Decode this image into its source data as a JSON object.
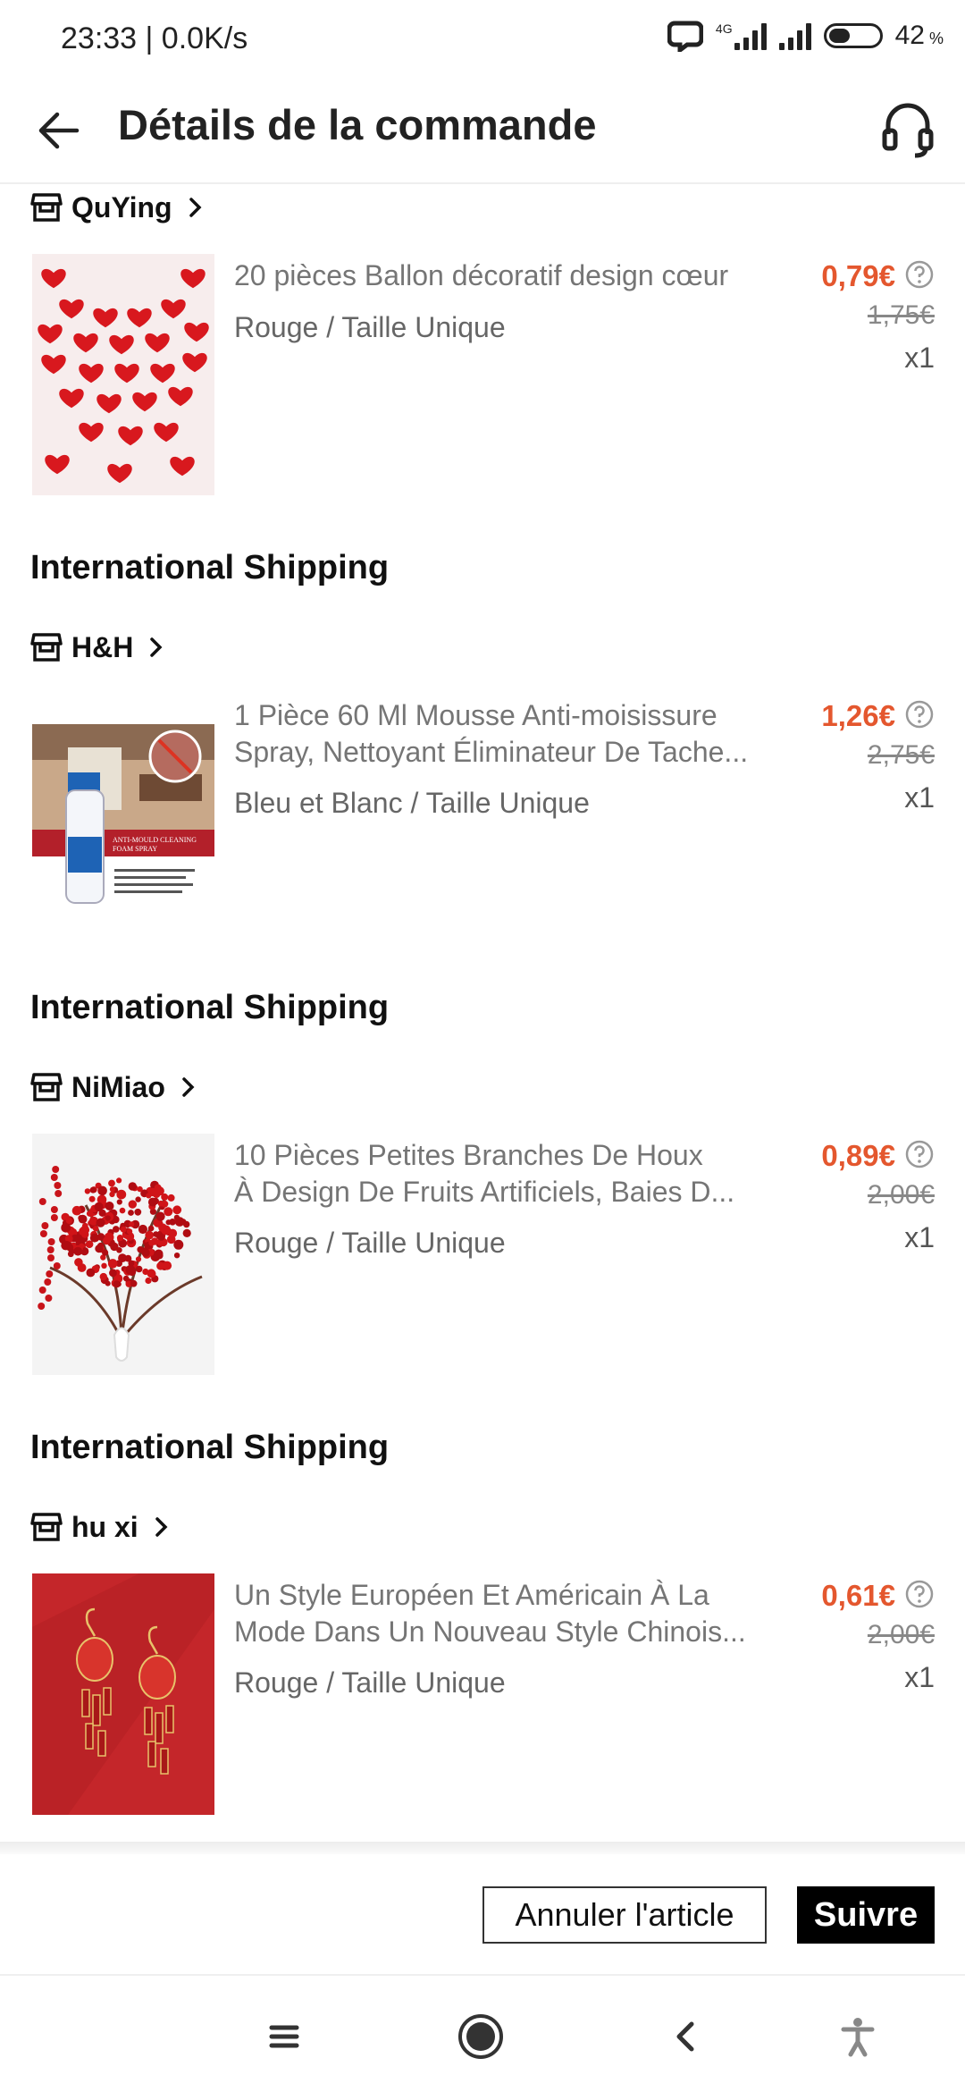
{
  "status_bar": {
    "time": "23:33 | 0.0K/s",
    "network": "4G",
    "battery": "42",
    "battery_level": 0.42
  },
  "header": {
    "title": "Détails de la commande",
    "back_icon": "back-arrow-icon",
    "support_icon": "headset-icon"
  },
  "orders": [
    {
      "section_title": "",
      "store": "QuYing",
      "product": {
        "title_lines": [
          "20 pièces Ballon décoratif design cœur"
        ],
        "variant": "Rouge / Taille Unique",
        "price": "0,79€",
        "original_price": "1,75€",
        "quantity": "x1",
        "image": "red-heart-balloons"
      }
    },
    {
      "section_title": "International Shipping",
      "store": "H&H",
      "product": {
        "title_lines": [
          "1 Pièce 60 Ml Mousse Anti-moisissure",
          "Spray, Nettoyant Éliminateur De Tache..."
        ],
        "variant": "Bleu et Blanc / Taille Unique",
        "price": "1,26€",
        "original_price": "2,75€",
        "quantity": "x1",
        "image": "anti-mould-spray-bottle",
        "image_caption": "ANTI-MOULD CLEANING FOAM SPRAY"
      }
    },
    {
      "section_title": "International Shipping",
      "store": "NiMiao",
      "product": {
        "title_lines": [
          "10 Pièces Petites Branches De Houx",
          "À Design De Fruits Artificiels, Baies D..."
        ],
        "variant": "Rouge / Taille Unique",
        "price": "0,89€",
        "original_price": "2,00€",
        "quantity": "x1",
        "image": "red-berry-branches"
      }
    },
    {
      "section_title": "International Shipping",
      "store": "hu xi",
      "product": {
        "title_lines": [
          "Un Style Européen Et Américain À La",
          "Mode Dans Un Nouveau Style Chinois..."
        ],
        "variant": "Rouge / Taille Unique",
        "price": "0,61€",
        "original_price": "2,00€",
        "quantity": "x1",
        "image": "red-lantern-earrings"
      }
    }
  ],
  "actions": {
    "cancel_label": "Annuler l'article",
    "follow_label": "Suivre"
  },
  "nav": [
    "menu-icon",
    "home-icon",
    "back-icon",
    "accessibility-icon"
  ],
  "colors": {
    "price": "#e4572e",
    "follow_bg": "#000000"
  }
}
